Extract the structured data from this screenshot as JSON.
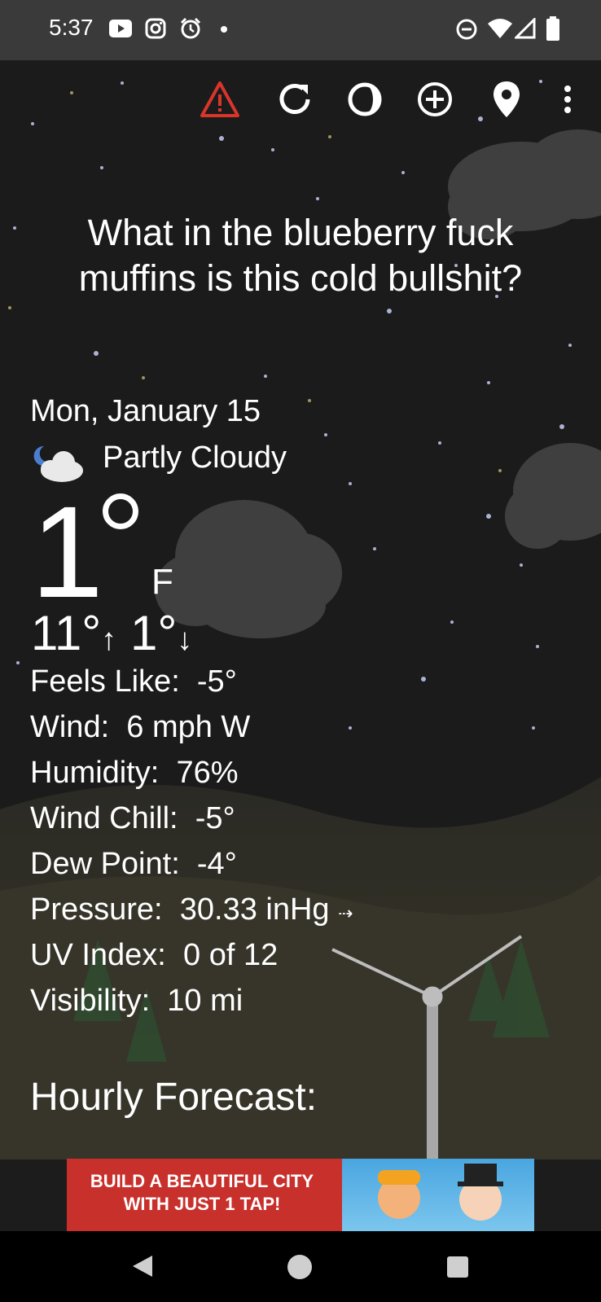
{
  "status_bar": {
    "time": "5:37",
    "left_icons": [
      "youtube-icon",
      "instagram-icon",
      "alarm-icon",
      "dot-icon"
    ],
    "right_icons": [
      "do-not-disturb-icon",
      "wifi-icon",
      "signal-icon",
      "battery-icon"
    ]
  },
  "toolbar": {
    "icons": [
      "alert-icon",
      "refresh-icon",
      "theme-icon",
      "add-location-icon",
      "location-pin-icon",
      "overflow-menu-icon"
    ],
    "alert_color": "#d9352b"
  },
  "quote": "What in the blueberry fuck muffins is this cold bullshit?",
  "weather": {
    "date": "Mon, January 15",
    "condition": "Partly Cloudy",
    "condition_icon": "partly-cloudy-night-icon",
    "temperature": "1",
    "unit": "F",
    "high": "11°",
    "low": "1°"
  },
  "details": [
    {
      "label": "Feels Like:",
      "value": "-5°"
    },
    {
      "label": "Wind:",
      "value": "6 mph W"
    },
    {
      "label": "Humidity:",
      "value": "76%"
    },
    {
      "label": "Wind Chill:",
      "value": "-5°"
    },
    {
      "label": "Dew Point:",
      "value": "-4°"
    },
    {
      "label": "Pressure:",
      "value": "30.33 inHg"
    },
    {
      "label": "UV Index:",
      "value": "0 of 12"
    },
    {
      "label": "Visibility:",
      "value": "10 mi"
    }
  ],
  "hourly_heading": "Hourly Forecast:",
  "ad": {
    "headline": "BUILD A BEAUTIFUL CITY WITH JUST 1 TAP!"
  },
  "nav": {
    "icons": [
      "back-icon",
      "home-icon",
      "recents-icon"
    ]
  }
}
